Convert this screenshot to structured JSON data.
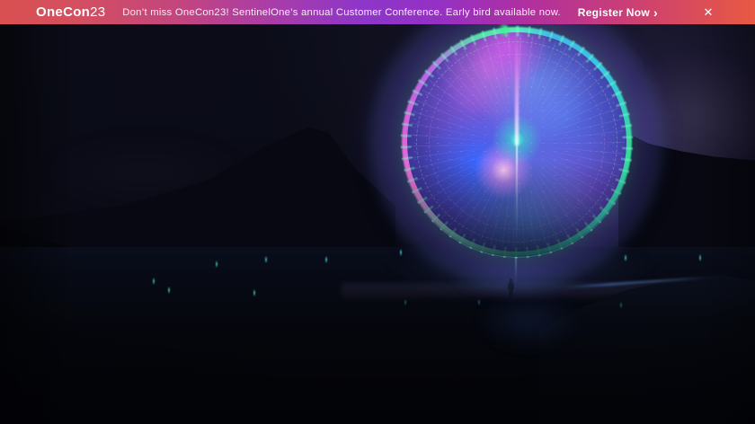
{
  "announcement_bar": {
    "logo": {
      "brand": "OneCon",
      "year": "23"
    },
    "message": "Don’t miss OneCon23! SentinelOne’s annual Customer Conference. Early bird available now.",
    "register": {
      "label": "Register Now",
      "chevron_icon": "›"
    },
    "close_icon": "✕",
    "colors": {
      "gradient_left": "#d95050",
      "gradient_pink": "#c2457f",
      "gradient_middle": "#8d36c9",
      "gradient_magenta": "#b0309f",
      "gradient_right": "#e85942",
      "text": "#f9edf7"
    }
  },
  "hero": {
    "description": "Dark night landscape: a lone silhouetted figure stands before a giant glowing iridescent circular portal between mountain silhouettes",
    "colors": {
      "sky": "#0b0c18",
      "portal_ring_green": "#52f0b8",
      "portal_ring_magenta": "#d862d8",
      "portal_core_blue": "#4f4aae",
      "portal_center_teal": "#3de8c4",
      "portal_glow_pink": "#f5b8e8",
      "ground_streak_teal": "#3fd8c8"
    }
  }
}
